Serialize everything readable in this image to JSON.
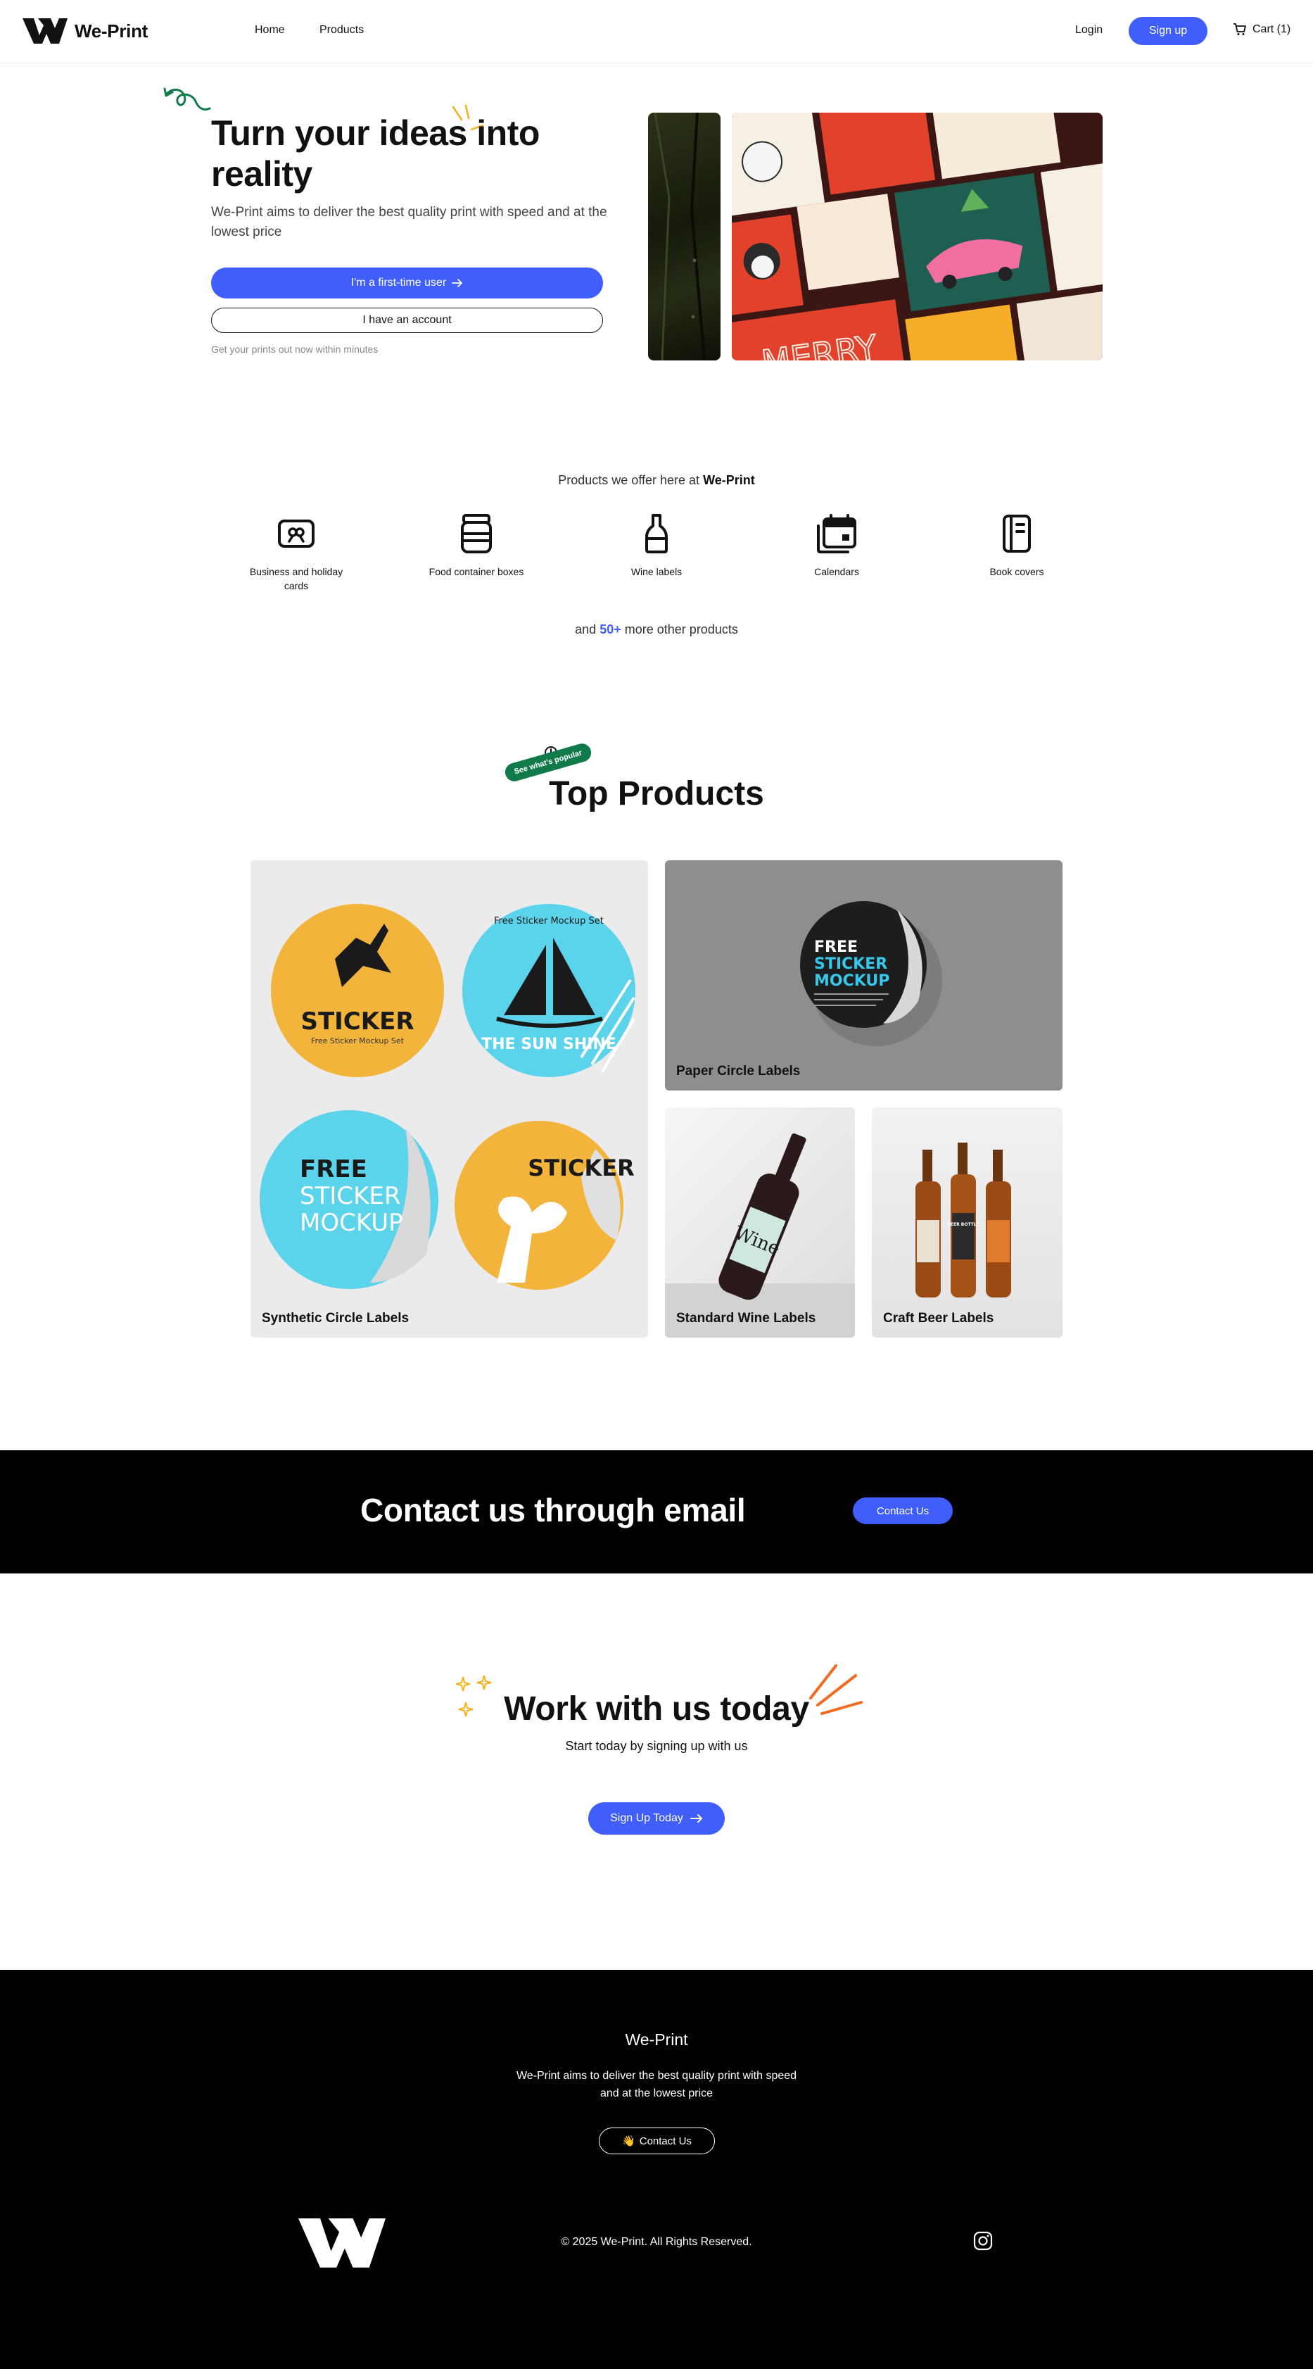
{
  "nav": {
    "brand": "We-Print",
    "links": [
      "Home",
      "Products"
    ],
    "login": "Login",
    "signup": "Sign up",
    "cart": "Cart (1)"
  },
  "hero": {
    "title": "Turn your ideas into reality",
    "subtitle": "We-Print aims to deliver the best quality print with speed and at the lowest price",
    "primary_cta": "I'm a first-time user",
    "secondary_cta": "I have an account",
    "note": "Get your prints out now within minutes"
  },
  "offer": {
    "title_prefix": "Products we offer here at",
    "title_brand": "We-Print",
    "items": [
      {
        "label": "Business and holiday cards",
        "icon": "gift-card-icon"
      },
      {
        "label": "Food container boxes",
        "icon": "food-container-icon"
      },
      {
        "label": "Wine labels",
        "icon": "wine-bottle-icon"
      },
      {
        "label": "Calendars",
        "icon": "calendar-icon"
      },
      {
        "label": "Book covers",
        "icon": "book-icon"
      }
    ],
    "more_prefix": "and",
    "more_count": "50+",
    "more_suffix": "more other products"
  },
  "top_products": {
    "tag": "See what's popular",
    "title": "Top Products",
    "cards": [
      {
        "label": "Synthetic Circle Labels"
      },
      {
        "label": "Paper Circle Labels"
      },
      {
        "label": "Standard Wine Labels"
      },
      {
        "label": "Craft Beer Labels"
      }
    ],
    "mockup_text": {
      "sticker": "STICKER",
      "sticker_sub": "Free Sticker Mockup Set",
      "sun_arc": "Free Sticker Mockup Set",
      "sun": "THE SUN SHINE",
      "free": "FREE",
      "mockup": "MOCKUP",
      "wine": "Wine",
      "beer": "BEER BOTTLE"
    }
  },
  "contact": {
    "title": "Contact us through email",
    "button": "Contact Us"
  },
  "work": {
    "title": "Work with us today",
    "subtitle": "Start today by signing up with us",
    "button": "Sign Up Today"
  },
  "footer": {
    "brand": "We-Print",
    "description": "We-Print aims to deliver the best quality print with speed and at the lowest price",
    "button_emoji": "👋",
    "button": "Contact Us",
    "copyright": "© 2025 We-Print. All Rights Reserved."
  },
  "colors": {
    "accent": "#3f5efb",
    "tag_green": "#117a4b",
    "spark_orange": "#f26b21",
    "spark_yellow": "#f2b21b"
  }
}
